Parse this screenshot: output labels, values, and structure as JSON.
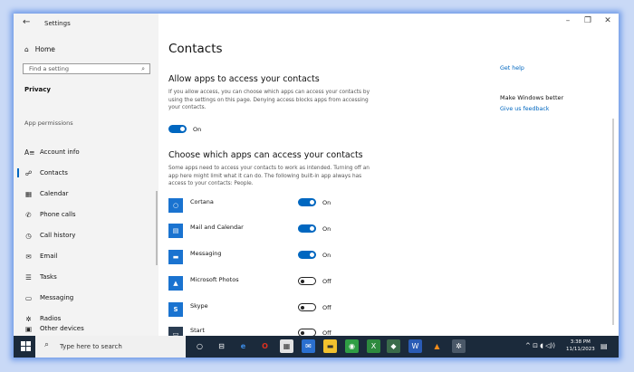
{
  "window": {
    "title": "Settings",
    "back_icon": "←",
    "minimize_icon": "–",
    "restore_icon": "❐",
    "close_icon": "✕"
  },
  "sidebar": {
    "home_label": "Home",
    "home_icon": "⌂",
    "search_placeholder": "Find a setting",
    "search_icon": "⌕",
    "section_title": "Privacy",
    "group_title": "App permissions",
    "items": [
      {
        "label": "Account info",
        "icon": "A≡"
      },
      {
        "label": "Contacts",
        "icon": "☍",
        "selected": true
      },
      {
        "label": "Calendar",
        "icon": "▦"
      },
      {
        "label": "Phone calls",
        "icon": "✆"
      },
      {
        "label": "Call history",
        "icon": "◷"
      },
      {
        "label": "Email",
        "icon": "✉"
      },
      {
        "label": "Tasks",
        "icon": "☰"
      },
      {
        "label": "Messaging",
        "icon": "▭"
      },
      {
        "label": "Radios",
        "icon": "✲"
      },
      {
        "label": "Other devices",
        "icon": "▣"
      }
    ]
  },
  "main": {
    "title": "Contacts",
    "allow": {
      "heading": "Allow apps to access your contacts",
      "description": "If you allow access, you can choose which apps can access your contacts by using the settings on this page. Denying access blocks apps from accessing your contacts.",
      "toggle_label": "On",
      "toggle_on": true
    },
    "choose": {
      "heading": "Choose which apps can access your contacts",
      "description": "Some apps need to access your contacts to work as intended. Turning off an app here might limit what it can do. The following built-in app always has access to your contacts: People."
    },
    "apps": [
      {
        "name": "Cortana",
        "state": "On",
        "on": true,
        "color": "#1a73d0",
        "icon": "○"
      },
      {
        "name": "Mail and Calendar",
        "state": "On",
        "on": true,
        "color": "#1a73d0",
        "icon": "▤"
      },
      {
        "name": "Messaging",
        "state": "On",
        "on": true,
        "color": "#1a73d0",
        "icon": "▬"
      },
      {
        "name": "Microsoft Photos",
        "state": "Off",
        "on": false,
        "color": "#1a73d0",
        "icon": "▲"
      },
      {
        "name": "Skype",
        "state": "Off",
        "on": false,
        "color": "#1a73d0",
        "icon": "S"
      },
      {
        "name": "Start",
        "state": "Off",
        "on": false,
        "color": "#2b3d52",
        "icon": "▭"
      }
    ]
  },
  "right_panel": {
    "get_help": "Get help",
    "make_better": "Make Windows better",
    "feedback": "Give us feedback"
  },
  "taskbar": {
    "search_placeholder": "Type here to search",
    "search_icon": "⌕",
    "time": "3:38 PM",
    "date": "11/11/2023",
    "tray_text": "^ ⊡ ◖ ◁))",
    "notification_icon": "▤"
  },
  "colors": {
    "accent": "#0067c0",
    "taskbar": "#1b2a3b"
  }
}
